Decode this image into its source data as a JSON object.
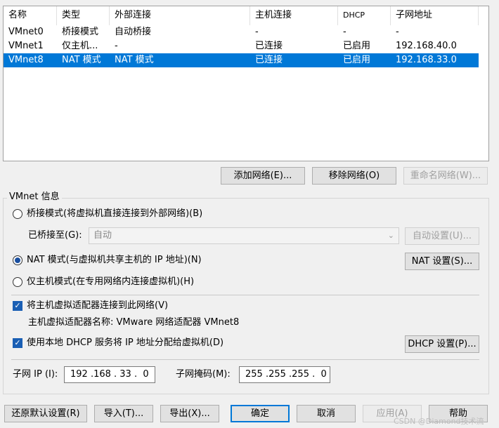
{
  "table": {
    "columns": [
      "名称",
      "类型",
      "外部连接",
      "主机连接",
      "DHCP",
      "子网地址"
    ],
    "rows": [
      {
        "name": "VMnet0",
        "type": "桥接模式",
        "external": "自动桥接",
        "host": "-",
        "dhcp": "-",
        "subnet": "-",
        "selected": false
      },
      {
        "name": "VMnet1",
        "type": "仅主机...",
        "external": "-",
        "host": "已连接",
        "dhcp": "已启用",
        "subnet": "192.168.40.0",
        "selected": false
      },
      {
        "name": "VMnet8",
        "type": "NAT 模式",
        "external": "NAT 模式",
        "host": "已连接",
        "dhcp": "已启用",
        "subnet": "192.168.33.0",
        "selected": true
      }
    ]
  },
  "net_buttons": {
    "add": "添加网络(E)...",
    "remove": "移除网络(O)",
    "rename": "重命名网络(W)..."
  },
  "vmnet_info": {
    "title": "VMnet 信息",
    "bridged_radio": "桥接模式(将虚拟机直接连接到外部网络)(B)",
    "bridged_to_label": "已桥接至(G):",
    "bridged_to_value": "自动",
    "auto_settings": "自动设置(U)...",
    "nat_radio": "NAT 模式(与虚拟机共享主机的 IP 地址)(N)",
    "nat_settings": "NAT 设置(S)...",
    "host_only_radio": "仅主机模式(在专用网络内连接虚拟机)(H)",
    "selected_mode": "nat",
    "connect_adapter": "将主机虚拟适配器连接到此网络(V)",
    "adapter_name": "主机虚拟适配器名称: VMware 网络适配器 VMnet8",
    "use_dhcp": "使用本地 DHCP 服务将 IP 地址分配给虚拟机(D)",
    "dhcp_settings": "DHCP 设置(P)...",
    "subnet_ip_label": "子网 IP (I):",
    "subnet_ip": "192 .168 . 33 .  0",
    "subnet_mask_label": "子网掩码(M):",
    "subnet_mask": "255 .255 .255 .  0"
  },
  "footer": {
    "restore_defaults": "还原默认设置(R)",
    "import": "导入(T)...",
    "export": "导出(X)...",
    "ok": "确定",
    "cancel": "取消",
    "apply": "应用(A)",
    "help": "帮助"
  },
  "watermark": "CSDN @Diamond技术流"
}
